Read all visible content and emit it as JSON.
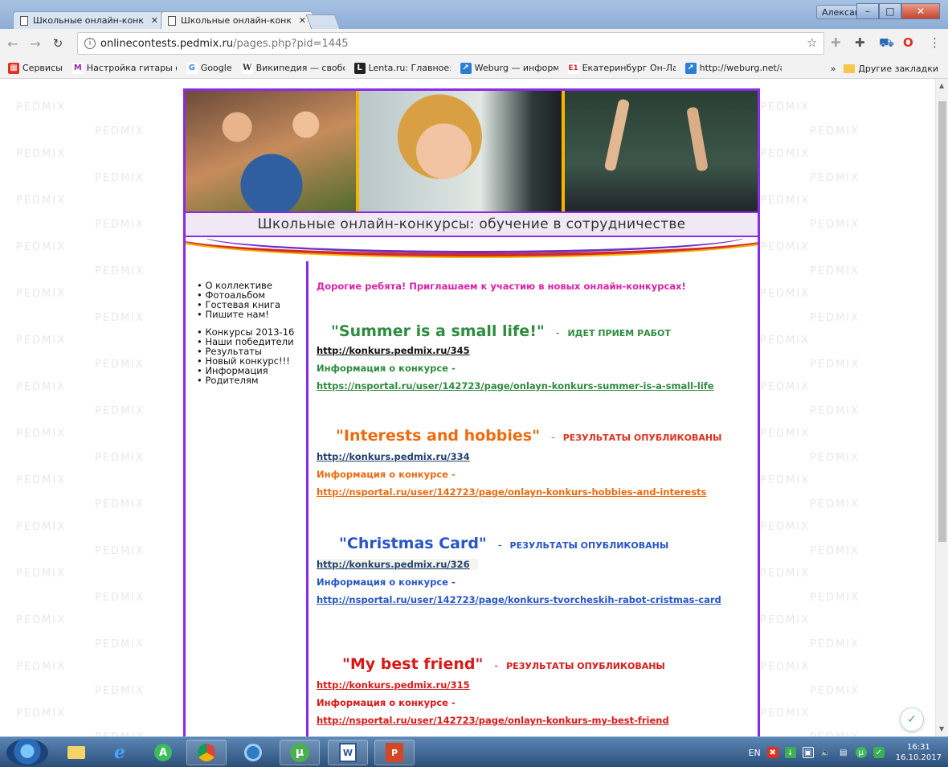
{
  "browser": {
    "tabs": [
      {
        "title": "Школьные онлайн-конк"
      },
      {
        "title": "Школьные онлайн-конк"
      }
    ],
    "user_name": "Александр",
    "url_host": "onlinecontests.pedmix.ru",
    "url_path": "/pages.php?pid=1445",
    "bookmarks": [
      {
        "label": "Сервисы",
        "icon": "apps-grid-icon",
        "color": "#e0301e"
      },
      {
        "label": "Настройка гитары о",
        "icon": "my-icon",
        "color": "#9c27b0"
      },
      {
        "label": "Google",
        "icon": "google-g-icon",
        "color": "#4285f4"
      },
      {
        "label": "Википедия — свобо",
        "icon": "wikipedia-w-icon",
        "color": "#333333"
      },
      {
        "label": "Lenta.ru: Главное:",
        "icon": "lenta-l-icon",
        "color": "#222222"
      },
      {
        "label": "Weburg — информа",
        "icon": "weburg-icon",
        "color": "#2a7fd4"
      },
      {
        "label": "Екатеринбург Он-Ла",
        "icon": "e1-icon",
        "color": "#d32f2f"
      },
      {
        "label": "http://weburg.net/ar",
        "icon": "weburg-icon",
        "color": "#2a7fd4"
      }
    ],
    "more_label": "»",
    "other_bookmarks": "Другие закладки"
  },
  "site": {
    "banner_title": "Школьные онлайн-конкурсы: обучение в сотрудничестве",
    "watermark": "PEDMIX",
    "nav_group1": [
      "О коллективе",
      "Фотоальбом",
      "Гостевая книга",
      "Пишите нам!"
    ],
    "nav_group2": [
      "Конкурсы 2013-16",
      "Наши победители",
      "Результаты",
      "Новый конкурс!!!",
      "Информация",
      "Родителям"
    ],
    "intro": "Дорогие ребята! Приглашаем к участию в новых онлайн-конкурсах!",
    "contests": [
      {
        "title": "\"Summer is a small life!\"",
        "dash": "-",
        "status": "ИДЕТ ПРИЕМ РАБОТ",
        "link": "http://konkurs.pedmix.ru/345",
        "info_label": "Информация о конкурсе -",
        "info_link": "https://nsportal.ru/user/142723/page/onlayn-konkurs-summer-is-a-small-life",
        "color": "#2e8b3f"
      },
      {
        "title": "\"Interests and hobbies\"",
        "dash": "-",
        "status": "РЕЗУЛЬТАТЫ ОПУБЛИКОВАНЫ",
        "link": "http://konkurs.pedmix.ru/334",
        "info_label": "Информация о конкурсе -",
        "info_link": "http://nsportal.ru/user/142723/page/onlayn-konkurs-hobbies-and-interests",
        "color": "#ef6a0e"
      },
      {
        "title": "\"Christmas Card\"",
        "dash": "-",
        "status": "РЕЗУЛЬТАТЫ ОПУБЛИКОВАНЫ",
        "link": "http://konkurs.pedmix.ru/326",
        "info_label": "Информация о конкурсе -",
        "info_link": "http://nsportal.ru/user/142723/page/konkurs-tvorcheskih-rabot-cristmas-card",
        "color": "#2856c6"
      },
      {
        "title": "\"My best friend\"",
        "dash": "-",
        "status": "РЕЗУЛЬТАТЫ ОПУБЛИКОВАНЫ",
        "link": "http://konkurs.pedmix.ru/315",
        "info_label": "Информация о конкурсе -",
        "info_link": "http://nsportal.ru/user/142723/page/onlayn-konkurs-my-best-friend",
        "color": "#d91919"
      }
    ]
  },
  "taskbar": {
    "lang": "EN",
    "time": "16:31",
    "date": "16.10.2017"
  }
}
